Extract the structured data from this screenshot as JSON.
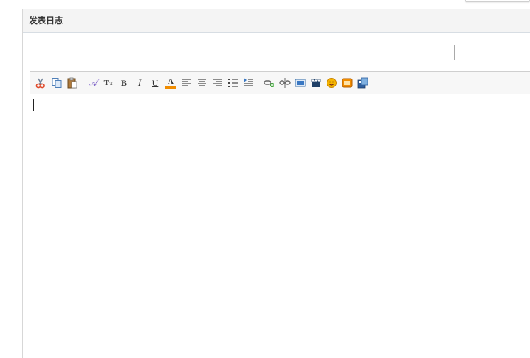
{
  "panel": {
    "title": "发表日志"
  },
  "title_input": {
    "value": "",
    "placeholder": ""
  },
  "editor": {
    "content": ""
  },
  "toolbar": {
    "items": [
      {
        "icon": "cut-icon"
      },
      {
        "icon": "copy-icon"
      },
      {
        "icon": "paste-icon"
      },
      {
        "icon": "font-family-icon"
      },
      {
        "icon": "font-size-icon"
      },
      {
        "icon": "bold-icon",
        "label": "B"
      },
      {
        "icon": "italic-icon",
        "label": "I"
      },
      {
        "icon": "underline-icon",
        "label": "U"
      },
      {
        "icon": "font-color-icon",
        "label": "A"
      },
      {
        "icon": "align-left-icon"
      },
      {
        "icon": "align-center-icon"
      },
      {
        "icon": "align-right-icon"
      },
      {
        "icon": "ordered-list-icon"
      },
      {
        "icon": "indent-icon"
      },
      {
        "icon": "insert-link-icon"
      },
      {
        "icon": "unlink-icon"
      },
      {
        "icon": "insert-image-icon"
      },
      {
        "icon": "insert-video-icon"
      },
      {
        "icon": "emoticon-icon"
      },
      {
        "icon": "insert-flash-icon"
      },
      {
        "icon": "save-draft-icon"
      }
    ]
  },
  "colors": {
    "header_bg": "#f4f4f4",
    "toolbar_bg": "#f7f7f7",
    "border": "#cfcfcf",
    "accent_orange": "#f08c00",
    "accent_blue": "#3a78c3"
  }
}
